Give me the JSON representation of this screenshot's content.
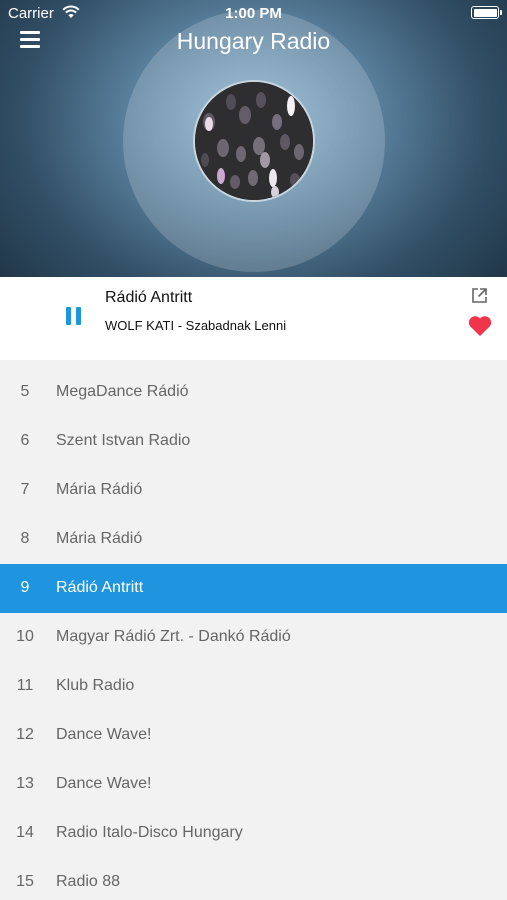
{
  "status_bar": {
    "carrier": "Carrier",
    "time": "1:00 PM"
  },
  "header": {
    "title": "Hungary Radio"
  },
  "player": {
    "station": "Rádió Antritt",
    "track": "WOLF KATI - Szabadnak Lenni",
    "state": "playing",
    "favorited": true,
    "accent_color": "#1f95e0",
    "heart_color": "#f0344a"
  },
  "stations": [
    {
      "num": "5",
      "name": "MegaDance Rádió"
    },
    {
      "num": "6",
      "name": "Szent Istvan Radio"
    },
    {
      "num": "7",
      "name": "Mária Rádió"
    },
    {
      "num": "8",
      "name": "Mária Rádió"
    },
    {
      "num": "9",
      "name": "Rádió Antritt",
      "selected": true
    },
    {
      "num": "10",
      "name": "Magyar Rádió Zrt. - Dankó Rádió"
    },
    {
      "num": "11",
      "name": "Klub Radio"
    },
    {
      "num": "12",
      "name": "Dance Wave!"
    },
    {
      "num": "13",
      "name": "Dance Wave!"
    },
    {
      "num": "14",
      "name": "Radio Italo-Disco Hungary"
    },
    {
      "num": "15",
      "name": "Radio 88"
    }
  ]
}
